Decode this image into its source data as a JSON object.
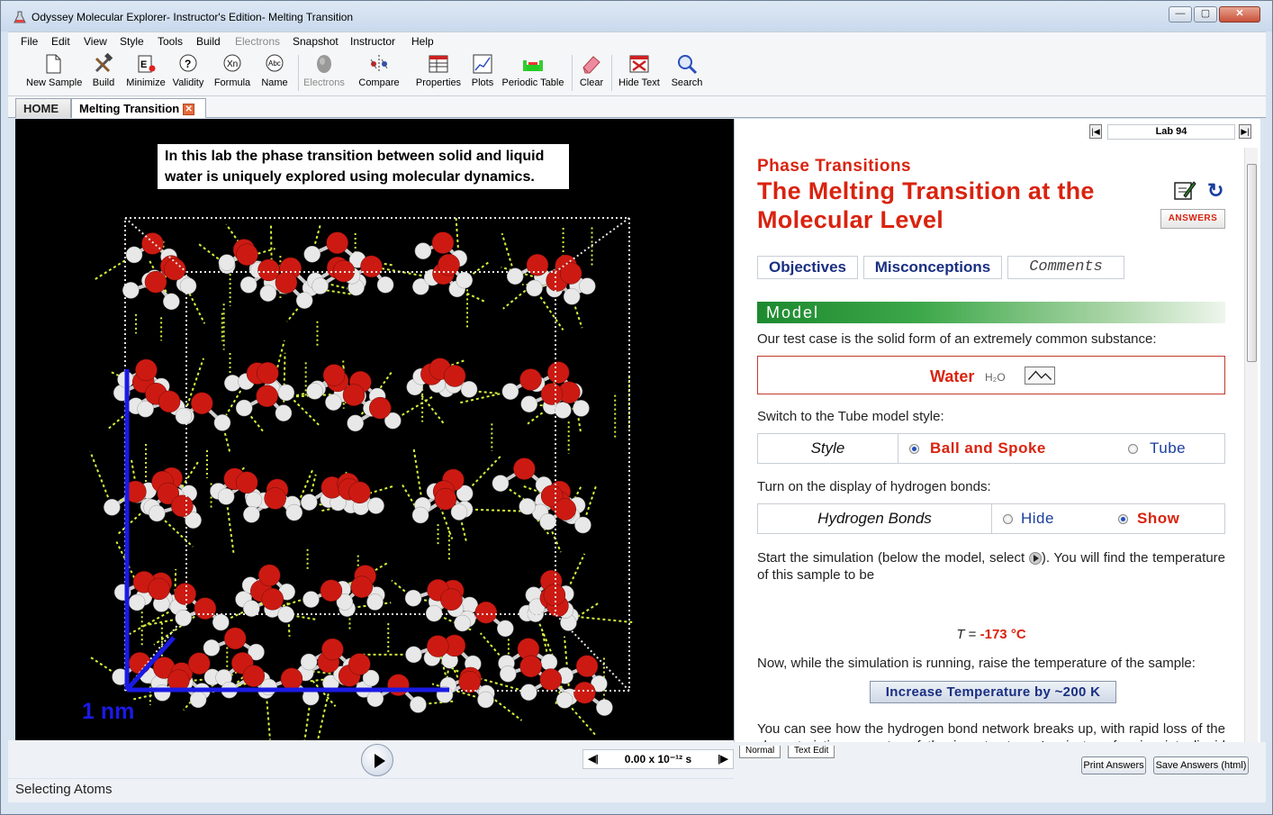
{
  "window": {
    "title": "Odyssey Molecular Explorer- Instructor's Edition- Melting Transition",
    "minimize_label": "—",
    "restore_label": "▢",
    "close_label": "✕"
  },
  "menu": [
    "File",
    "Edit",
    "View",
    "Style",
    "Tools",
    "Build",
    "Electrons",
    "Snapshot",
    "Instructor",
    "Help"
  ],
  "toolbar": {
    "new_sample": "New Sample",
    "build": "Build",
    "minimize": "Minimize",
    "validity": "Validity",
    "formula": "Formula",
    "name": "Name",
    "electrons": "Electrons",
    "compare": "Compare",
    "properties": "Properties",
    "plots": "Plots",
    "periodic_table": "Periodic Table",
    "clear": "Clear",
    "hide_text": "Hide Text",
    "search": "Search"
  },
  "tabs": {
    "home": "HOME",
    "active": "Melting Transition"
  },
  "viewer": {
    "caption": "In this lab the phase transition between solid and liquid water is uniquely explored using molecular dynamics.",
    "scale_label": "1 nm",
    "time_display": "0.00 x 10⁻¹² s"
  },
  "status": {
    "text": "Selecting Atoms"
  },
  "panel": {
    "lab_number": "Lab 94",
    "subject": "Phase Transitions",
    "title": "The Melting Transition at the Molecular Level",
    "answers_button": "ANSWERS",
    "info_tabs": {
      "objectives": "Objectives",
      "misconceptions": "Misconceptions",
      "comments": "Comments"
    },
    "model_header": "Model",
    "p1": "Our test case is the solid form of an extremely common substance:",
    "water_name": "Water",
    "water_formula": "H₂O",
    "p2": "Switch to the Tube model style:",
    "style_label": "Style",
    "style_option_1": "Ball and Spoke",
    "style_option_2": "Tube",
    "p3": "Turn on the display of hydrogen bonds:",
    "hbond_label": "Hydrogen Bonds",
    "hbond_option_1": "Hide",
    "hbond_option_2": "Show",
    "p4_start": "Start the simulation (below the model, select",
    "p4_end": "). You will find the temperature of this sample to be",
    "temp_symbol": "T",
    "temp_eq": " = ",
    "temp_value": "-173 °C",
    "p5": "Now, while the simulation is running, raise the temperature of the sample:",
    "increase_button": "Increase Temperature by ~200 K",
    "p6": "You can see how the hydrogen bond network breaks up, with rapid loss of the characteristic symmetry of the ice structure. Ice is transforming into liquid water!"
  },
  "bottom": {
    "mode_normal": "Normal",
    "mode_text_edit": "Text Edit",
    "print_answers": "Print Answers",
    "save_answers": "Save Answers (html)"
  },
  "colors": {
    "accent_red": "#d9230f",
    "link_blue": "#1a2f82",
    "oxygen": "#cc1a12",
    "hydrogen": "#e8e8e8",
    "hbond": "#d8f23c",
    "axis_blue": "#1a1ae6"
  }
}
